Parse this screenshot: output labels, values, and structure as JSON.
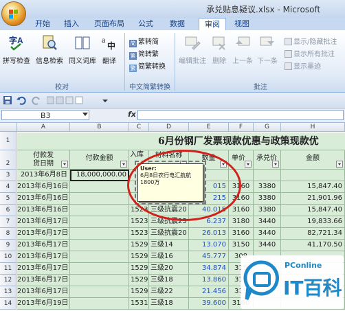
{
  "window": {
    "title": "承兑贴息疑议.xlsx - Microsoft"
  },
  "colors": {
    "accent": "#15428b",
    "sheet_fill": "#d8ecd8",
    "comment_bg": "#ffffe1",
    "highlight_ring": "#d0211c",
    "watermark_blue": "#1e88c8"
  },
  "ribbon_tabs": [
    "开始",
    "插入",
    "页面布局",
    "公式",
    "数据",
    "审阅",
    "视图"
  ],
  "active_tab": "审阅",
  "ribbon": {
    "proofing": {
      "label": "校对",
      "spell": "拼写检查",
      "research": "信息检索",
      "thesaurus": "同义词库",
      "translate": "翻译"
    },
    "chinese": {
      "label": "中文简繁转换",
      "to_simplified": "繁转简",
      "to_traditional": "简转繁",
      "convert": "简繁转换"
    },
    "comments": {
      "label": "批注",
      "edit": "编辑批注",
      "delete": "删除",
      "prev": "上一条",
      "next": "下一条",
      "show_hide": "显示/隐藏批注",
      "show_all": "显示所有批注",
      "show_ink": "显示墨迹"
    }
  },
  "formula_bar": {
    "name_box": "B3",
    "fx": "fx",
    "value": ""
  },
  "columns": [
    "A",
    "B",
    "C",
    "D",
    "E",
    "F",
    "G",
    "H"
  ],
  "sheet_title": "6月份钢厂发票现款优惠与政策现款优",
  "headers": {
    "a": "付款发\n货日期",
    "b": "付款金额",
    "c": "入库",
    "d": "材料名称",
    "e": "数量",
    "f": "单价",
    "g": "承兑价",
    "h": "金额"
  },
  "rows": [
    {
      "n": "3",
      "a": "2013年6月8日",
      "b": "18,000,000.00",
      "c": "",
      "d": "",
      "e": "",
      "f": "",
      "g": "",
      "h": ""
    },
    {
      "n": "4",
      "a": "2013年6月16日",
      "b": "",
      "c": "",
      "d": "",
      "e": "015",
      "f": "3160",
      "g": "3380",
      "h": "15,847.40"
    },
    {
      "n": "5",
      "a": "2013年6月16日",
      "b": "",
      "c": "",
      "d": "",
      "e": "215",
      "f": "3160",
      "g": "3380",
      "h": "21,901.96"
    },
    {
      "n": "6",
      "a": "2013年6月16日",
      "b": "",
      "c": "1523",
      "d": "三级抗震20",
      "e": "40.015",
      "f": "3160",
      "g": "3380",
      "h": "15,847.40"
    },
    {
      "n": "7",
      "a": "2013年6月17日",
      "b": "",
      "c": "1523",
      "d": "三级抗震25",
      "e": "6.237",
      "f": "3180",
      "g": "3440",
      "h": "19,833.66"
    },
    {
      "n": "8",
      "a": "2013年6月17日",
      "b": "",
      "c": "1523",
      "d": "三级抗震20",
      "e": "26.013",
      "f": "3160",
      "g": "3440",
      "h": "82,721.34"
    },
    {
      "n": "9",
      "a": "2013年6月17日",
      "b": "",
      "c": "1529",
      "d": "三级14",
      "e": "13.070",
      "f": "3150",
      "g": "3440",
      "h": "41,170.50"
    },
    {
      "n": "10",
      "a": "2013年6月17日",
      "b": "",
      "c": "1529",
      "d": "三级16",
      "e": "45.777",
      "f": "308",
      "g": "",
      "h": ""
    },
    {
      "n": "11",
      "a": "2013年6月17日",
      "b": "",
      "c": "1529",
      "d": "三级20",
      "e": "34.874",
      "f": "315",
      "g": "",
      "h": ""
    },
    {
      "n": "12",
      "a": "2013年6月17日",
      "b": "",
      "c": "1529",
      "d": "三级18",
      "e": "13.860",
      "f": "315",
      "g": "",
      "h": ""
    },
    {
      "n": "13",
      "a": "2013年6月17日",
      "b": "",
      "c": "1529",
      "d": "三级22",
      "e": "21.456",
      "f": "315",
      "g": "",
      "h": ""
    },
    {
      "n": "14",
      "a": "2013年6月19日",
      "b": "",
      "c": "1531",
      "d": "三级18",
      "e": "39.600",
      "f": "3160",
      "g": "",
      "h": ""
    }
  ],
  "comment": {
    "author": "User:",
    "text": "6月8日农行电汇航航1800万"
  },
  "watermark": {
    "brand": "PConline",
    "name": "IT百科"
  }
}
